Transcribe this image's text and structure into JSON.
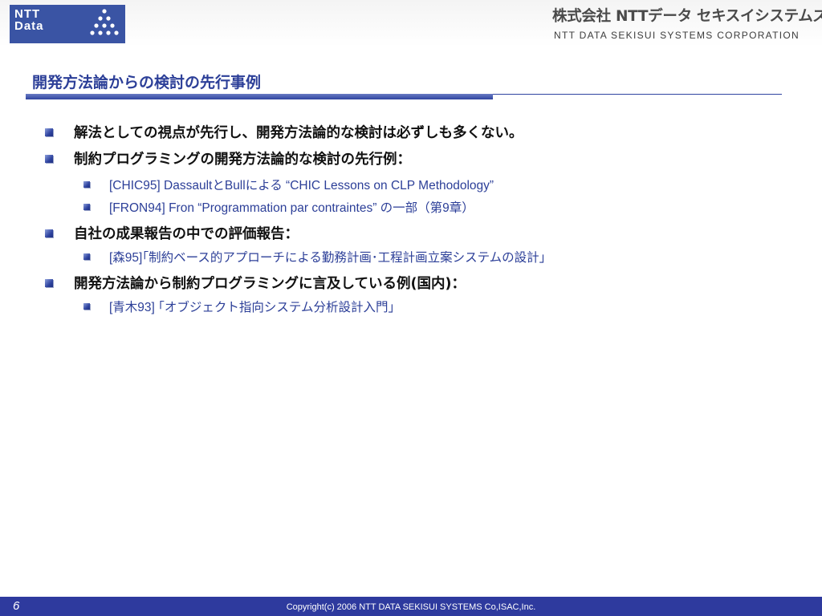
{
  "header": {
    "logo_text_line1": "NTT",
    "logo_text_line2": "Data",
    "company_jp": "株式会社 NTTデータ セキスイシステムズ",
    "company_en": "NTT DATA SEKISUI SYSTEMS CORPORATION",
    "logo_color": "#3a54a4"
  },
  "slide": {
    "title": "開発方法論からの検討の先行事例",
    "bullets": [
      {
        "text": "解法としての視点が先行し、開発方法論的な検討は必ずしも多くない。"
      },
      {
        "text": "制約プログラミングの開発方法論的な検討の先行例："
      },
      {
        "text": "[CHIC95] DassaultとBullによる “CHIC Lessons on CLP Methodology”"
      },
      {
        "text": "[FRON94] Fron “Programmation par contraintes” の一部（第9章）"
      },
      {
        "text": "自社の成果報告の中での評価報告："
      },
      {
        "text": "[森95]｢制約ベース的アプローチによる勤務計画･工程計画立案システムの設計｣"
      },
      {
        "text": "開発方法論から制約プログラミングに言及している例(国内)："
      },
      {
        "text": "[青木93] ｢オブジェクト指向システム分析設計入門｣"
      }
    ]
  },
  "footer": {
    "page_number": "6",
    "copyright": "Copyright(c) 2006 NTT DATA SEKISUI SYSTEMS Co,ISAC,Inc.",
    "bar_color": "#2e3a9e"
  }
}
